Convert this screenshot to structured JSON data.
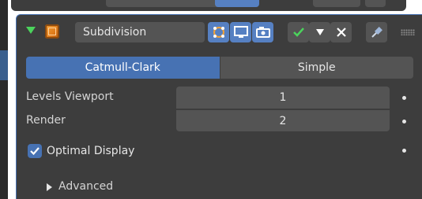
{
  "modifier": {
    "name": "Subdivision",
    "icons": {
      "collapse": "chevron-down-icon",
      "type": "subdivision-modifier-icon",
      "on_cage": "on-cage-icon",
      "edit_mode": "edit-mode-icon",
      "render": "camera-icon",
      "apply": "checkmark-icon",
      "dropdown": "triangle-down-icon",
      "close": "close-icon",
      "pin": "pin-icon",
      "grip": "drag-grip-icon"
    },
    "colors": {
      "accent": "#4772b3",
      "panel_bg": "#3d3d3d",
      "field_bg": "#545454",
      "check_green": "#4bd35c",
      "modifier_orange": "#e88b26"
    }
  },
  "tabs": [
    {
      "label": "Catmull-Clark",
      "active": true
    },
    {
      "label": "Simple",
      "active": false
    }
  ],
  "properties": {
    "levels_viewport": {
      "label": "Levels Viewport",
      "value": "1"
    },
    "render": {
      "label": "Render",
      "value": "2"
    }
  },
  "optimal_display": {
    "label": "Optimal Display",
    "checked": true
  },
  "advanced": {
    "label": "Advanced",
    "expanded": false
  }
}
